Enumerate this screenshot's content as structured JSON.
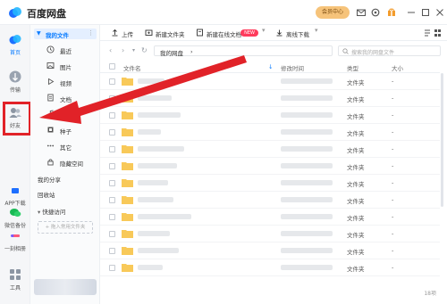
{
  "app": {
    "title": "百度网盘",
    "member_button": "会员中心"
  },
  "colors": {
    "accent": "#0a7cff",
    "highlight_box": "#e12228",
    "arrow": "#e12228",
    "folder": "#f8c959",
    "new_badge": "#ff3b5c"
  },
  "rail": {
    "items": [
      {
        "label": "首页",
        "icon": "home-icon"
      },
      {
        "label": "传输",
        "icon": "transfer-icon"
      },
      {
        "label": "好友",
        "icon": "friends-icon"
      },
      {
        "label": "APP下载",
        "icon": "app-download-icon"
      },
      {
        "label": "微信备份",
        "icon": "wechat-backup-icon"
      },
      {
        "label": "一刻相册",
        "icon": "album-icon"
      },
      {
        "label": "工具",
        "icon": "tools-icon"
      }
    ]
  },
  "sidebar": {
    "my_files": "我的文件",
    "items": [
      {
        "label": "最近",
        "icon": "clock-icon"
      },
      {
        "label": "图片",
        "icon": "image-icon"
      },
      {
        "label": "视频",
        "icon": "video-icon"
      },
      {
        "label": "文档",
        "icon": "document-icon"
      },
      {
        "label": "音乐",
        "icon": "music-icon"
      },
      {
        "label": "种子",
        "icon": "torrent-icon"
      },
      {
        "label": "其它",
        "icon": "more-icon"
      },
      {
        "label": "隐藏空间",
        "icon": "lock-icon"
      }
    ],
    "my_share": "我的分享",
    "recycle": "回收站",
    "quick_access": "快捷访问",
    "quick_add": "+ 拖入常用文件夹"
  },
  "toolbar": {
    "upload": "上传",
    "new_folder": "新建文件夹",
    "new_online_doc": "新建在线文档",
    "new_badge": "NEW",
    "offline_download": "离线下载"
  },
  "nav": {
    "breadcrumb": "我的网盘",
    "search_placeholder": "搜索我的网盘文件"
  },
  "table": {
    "headers": {
      "name": "文件名",
      "modified": "修改时间",
      "type": "类型",
      "size": "大小"
    },
    "rows": [
      {
        "type": "文件夹",
        "size": "-"
      },
      {
        "type": "文件夹",
        "size": "-"
      },
      {
        "type": "文件夹",
        "size": "-"
      },
      {
        "type": "文件夹",
        "size": "-"
      },
      {
        "type": "文件夹",
        "size": "-"
      },
      {
        "type": "文件夹",
        "size": "-"
      },
      {
        "type": "文件夹",
        "size": "-"
      },
      {
        "type": "文件夹",
        "size": "-"
      },
      {
        "type": "文件夹",
        "size": "-"
      },
      {
        "type": "文件夹",
        "size": "-"
      },
      {
        "type": "文件夹",
        "size": "-"
      },
      {
        "type": "文件夹",
        "size": "-"
      }
    ],
    "count": "18项"
  }
}
